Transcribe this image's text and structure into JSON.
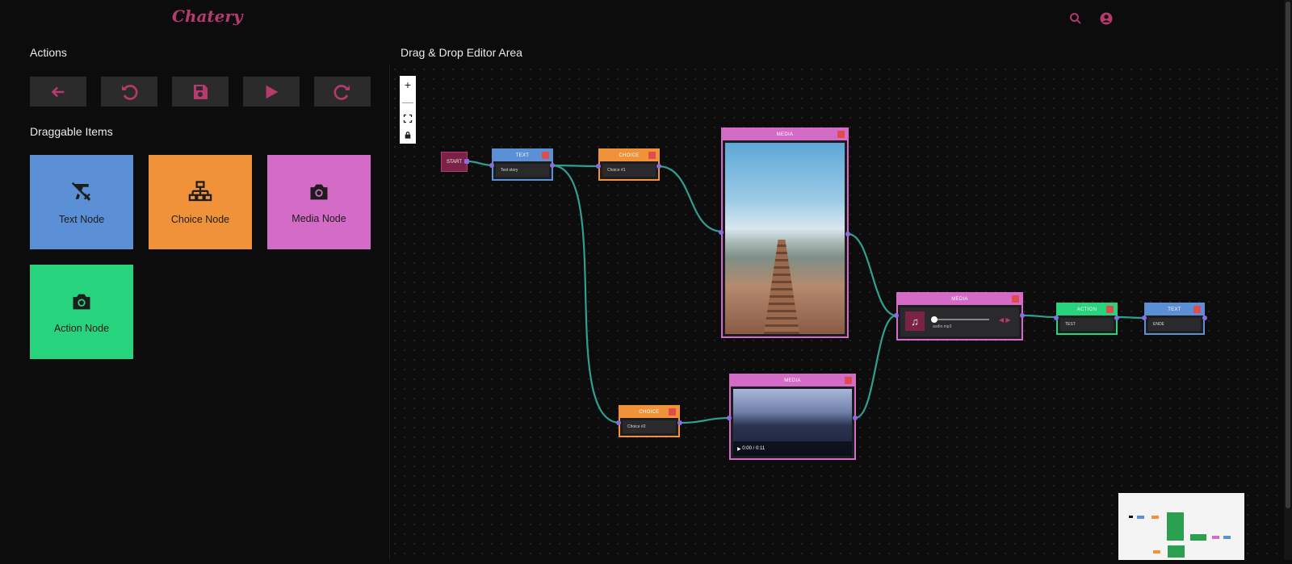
{
  "app": {
    "brand": "Chatery"
  },
  "header": {
    "icons": [
      "search-icon",
      "account-circle-icon"
    ]
  },
  "actions": {
    "title": "Actions",
    "buttons": [
      "back-arrow-icon",
      "undo-icon",
      "save-icon",
      "play-icon",
      "redo-icon"
    ],
    "accent": "#b83a6c"
  },
  "draggable": {
    "title": "Draggable Items",
    "items": [
      {
        "label": "Text Node",
        "icon": "text-format-clear-icon",
        "color": "#5b8fd6"
      },
      {
        "label": "Choice Node",
        "icon": "sitemap-icon",
        "color": "#f0923a"
      },
      {
        "label": "Media Node",
        "icon": "camera-icon",
        "color": "#d46bc6"
      },
      {
        "label": "Action Node",
        "icon": "camera-icon",
        "color": "#27d47d"
      }
    ]
  },
  "editor": {
    "title": "Drag & Drop Editor Area",
    "zoom_controls": [
      "+",
      "—",
      "fit-view-icon",
      "lock-icon"
    ],
    "start_label": "START",
    "nodes": [
      {
        "type": "TEXT",
        "content": "Test story"
      },
      {
        "type": "CHOICE",
        "content": "Choice #1"
      },
      {
        "type": "MEDIA",
        "content": "image"
      },
      {
        "type": "CHOICE",
        "content": "Choice #2"
      },
      {
        "type": "MEDIA",
        "content": "video",
        "time": "0:00 / 0:11"
      },
      {
        "type": "MEDIA",
        "content": "audio",
        "track": "audio.mp3"
      },
      {
        "type": "ACTION",
        "content": "TEST"
      },
      {
        "type": "TEXT",
        "content": "ENDE"
      }
    ],
    "edge_color": "#2fa08f"
  }
}
